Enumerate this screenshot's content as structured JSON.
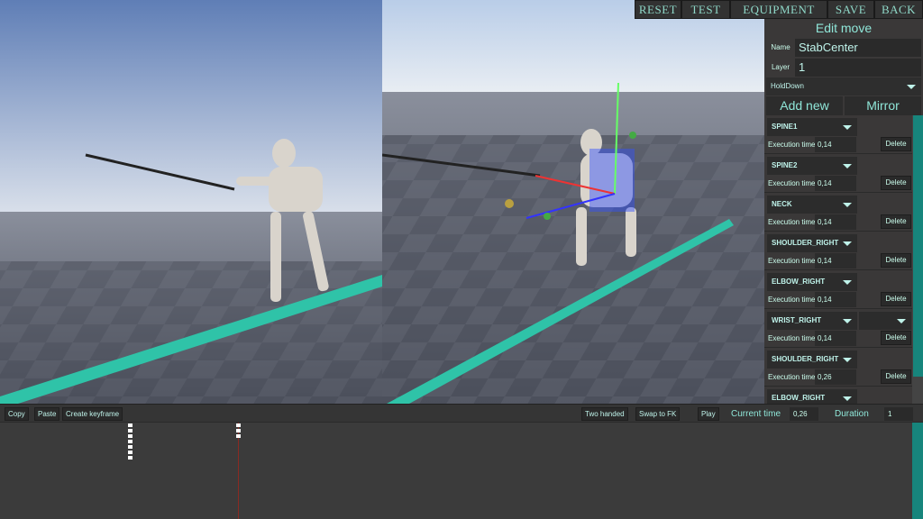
{
  "topbar": {
    "reset": "RESET",
    "test": "TEST",
    "equipment": "EQUIPMENT",
    "save": "SAVE",
    "back": "BACK"
  },
  "panel": {
    "title": "Edit move",
    "name_label": "Name",
    "name_value": "StabCenter",
    "layer_label": "Layer",
    "layer_value": "1",
    "mode": "HoldDown",
    "add_new": "Add new",
    "mirror": "Mirror"
  },
  "bones": [
    {
      "bone": "SPINE1",
      "exec_label": "Execution time",
      "exec": "0,14",
      "delete": "Delete"
    },
    {
      "bone": "SPINE2",
      "exec_label": "Execution time",
      "exec": "0,14",
      "delete": "Delete"
    },
    {
      "bone": "NECK",
      "exec_label": "Execution time",
      "exec": "0,14",
      "delete": "Delete"
    },
    {
      "bone": "SHOULDER_RIGHT",
      "exec_label": "Execution time",
      "exec": "0,14",
      "delete": "Delete"
    },
    {
      "bone": "ELBOW_RIGHT",
      "exec_label": "Execution time",
      "exec": "0,14",
      "delete": "Delete"
    },
    {
      "bone": "WRIST_RIGHT",
      "exec_label": "Execution time",
      "exec": "0,14",
      "delete": "Delete"
    },
    {
      "bone": "SHOULDER_RIGHT",
      "exec_label": "Execution time",
      "exec": "0,26",
      "delete": "Delete"
    },
    {
      "bone": "ELBOW_RIGHT",
      "exec_label": "",
      "exec": "",
      "delete": ""
    }
  ],
  "timeline_bar": {
    "copy": "Copy",
    "paste": "Paste",
    "create_keyframe": "Create keyframe",
    "two_handed": "Two handed",
    "swap_fk": "Swap to FK",
    "play": "Play",
    "current_time_label": "Current time",
    "current_time": "0,26",
    "duration_label": "Duration",
    "duration": "1"
  },
  "colors": {
    "accent": "#8fe6d8",
    "scrollbar": "#17857c",
    "floor_line": "#2fc3a8"
  }
}
